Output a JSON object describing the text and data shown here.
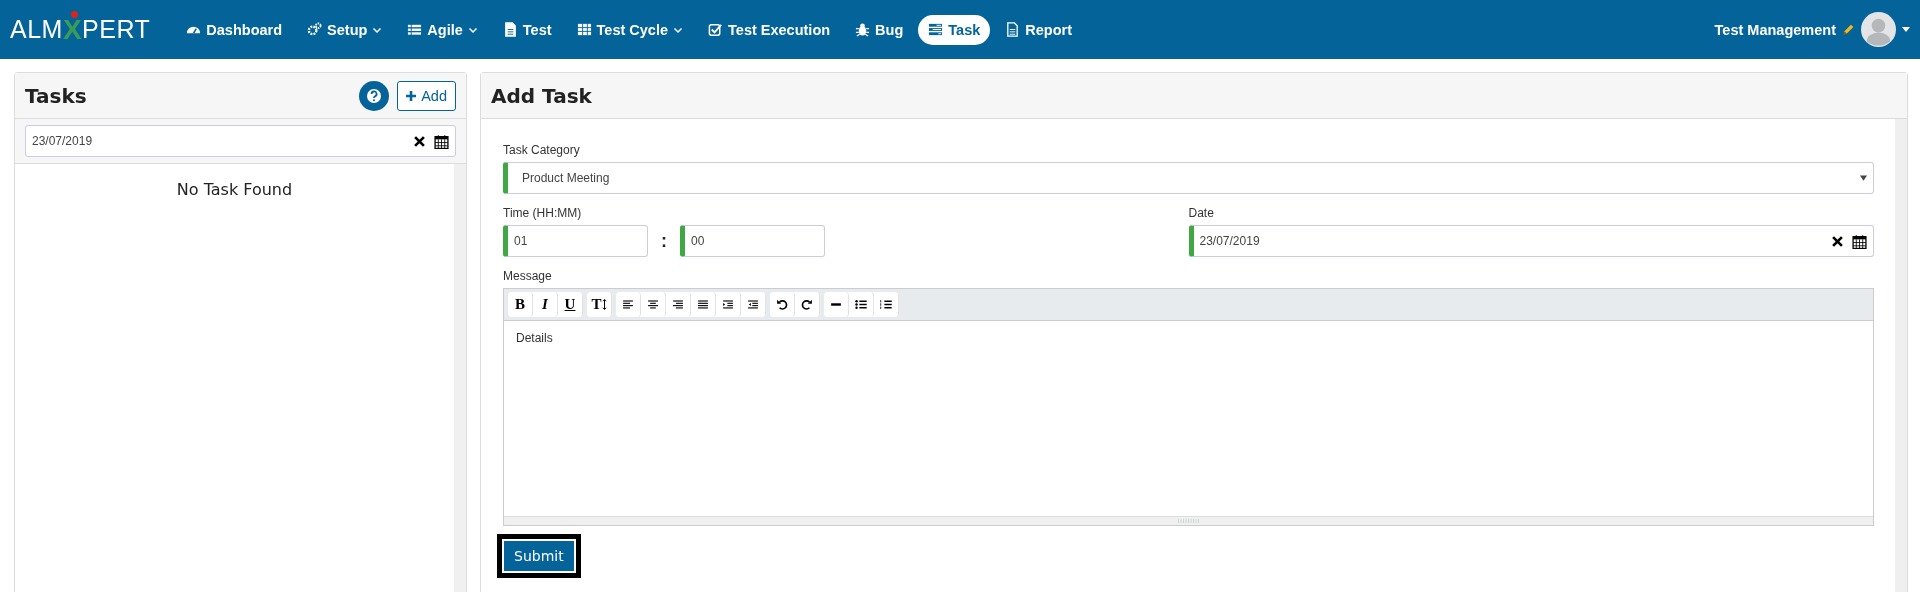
{
  "navbar": {
    "logo": [
      {
        "text": "ALM",
        "kind": "plain"
      },
      {
        "text": "X",
        "kind": "accent"
      },
      {
        "text": "PERT",
        "kind": "plain"
      }
    ],
    "items": [
      {
        "label": "Dashboard",
        "kind": "dashboard",
        "dropdown": false,
        "selected": false
      },
      {
        "label": "Setup",
        "kind": "cogs",
        "dropdown": true,
        "selected": false
      },
      {
        "label": "Agile",
        "kind": "list",
        "dropdown": true,
        "selected": false
      },
      {
        "label": "Test",
        "kind": "file",
        "dropdown": false,
        "selected": false
      },
      {
        "label": "Test Cycle",
        "kind": "table",
        "dropdown": true,
        "selected": false
      },
      {
        "label": "Test Execution",
        "kind": "check",
        "dropdown": false,
        "selected": false
      },
      {
        "label": "Bug",
        "kind": "bug",
        "dropdown": false,
        "selected": false
      },
      {
        "label": "Task",
        "kind": "tasks",
        "dropdown": false,
        "selected": true
      },
      {
        "label": "Report",
        "kind": "report",
        "dropdown": false,
        "selected": false
      }
    ],
    "user": {
      "name": "Test Management"
    }
  },
  "tasks_panel": {
    "title": "Tasks",
    "add_button": "Add",
    "date_filter": {
      "value": "23/07/2019"
    },
    "empty_message": "No Task Found"
  },
  "add_task": {
    "title": "Add Task",
    "task_category": {
      "label": "Task Category",
      "value": "Product Meeting"
    },
    "time": {
      "label": "Time (HH:MM)",
      "hours": "01",
      "separator": ":",
      "minutes": "00"
    },
    "date": {
      "label": "Date",
      "value": "23/07/2019"
    },
    "message": {
      "label": "Message",
      "value": "Details",
      "toolbar": [
        [
          {
            "kind": "bold",
            "text": "B"
          },
          {
            "kind": "italic",
            "text": "I"
          },
          {
            "kind": "underline",
            "text": "U"
          }
        ],
        [
          {
            "kind": "fontsize",
            "text": "T"
          }
        ],
        [
          {
            "kind": "align-left"
          },
          {
            "kind": "align-center"
          },
          {
            "kind": "align-right"
          },
          {
            "kind": "justify"
          },
          {
            "kind": "indent"
          },
          {
            "kind": "outdent"
          }
        ],
        [
          {
            "kind": "undo"
          },
          {
            "kind": "redo"
          }
        ],
        [
          {
            "kind": "rule"
          },
          {
            "kind": "bullets"
          },
          {
            "kind": "numbers"
          }
        ]
      ]
    },
    "submit": {
      "label": "Submit",
      "focused": true
    }
  }
}
